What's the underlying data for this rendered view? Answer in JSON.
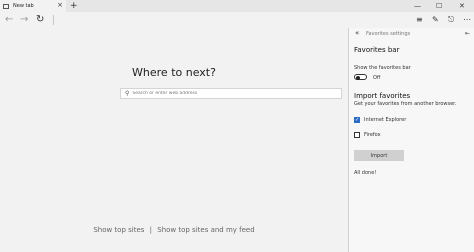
{
  "tab": {
    "title": "New tab",
    "close": "×",
    "new_tab": "+"
  },
  "window_controls": {
    "minimize": "—",
    "maximize": "☐",
    "close": "✕"
  },
  "toolbar": {
    "back": "←",
    "forward": "→",
    "refresh": "↻"
  },
  "page": {
    "heading": "Where to next?",
    "search_placeholder": "Search or enter web address",
    "link_top_sites": "Show top sites",
    "link_divider": "|",
    "link_top_sites_feed": "Show top sites and my feed"
  },
  "panel": {
    "back": "«",
    "title": "Favorites settings",
    "pin": "⇤",
    "favorites_bar_heading": "Favorites bar",
    "show_bar_label": "Show the favorites bar",
    "toggle_state": "Off",
    "import_heading": "Import favorites",
    "import_desc": "Get your favorites from another browser.",
    "browsers": [
      {
        "label": "Internet Explorer",
        "checked": true
      },
      {
        "label": "Firefox",
        "checked": false
      }
    ],
    "import_button": "Import",
    "status": "All done!"
  },
  "colors": {
    "accent": "#2b6cc4",
    "panel_bg": "#f7f7f7",
    "page_bg": "#f2f2f2"
  }
}
